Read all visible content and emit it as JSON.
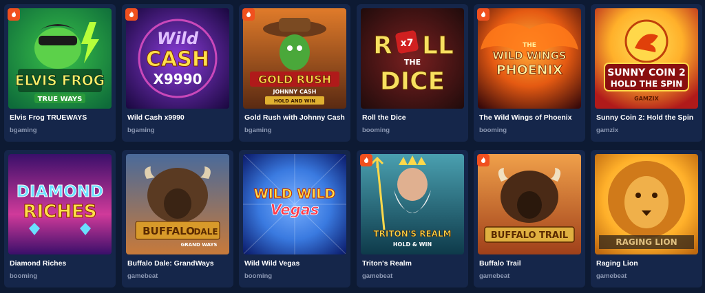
{
  "games": [
    {
      "title": "Elvis Frog TRUEWAYS",
      "provider": "bgaming",
      "hot": true,
      "art_lines": [
        "ELVIS FROG",
        "TRUE WAYS"
      ],
      "colors": [
        "#0e6b3a",
        "#39c24a"
      ]
    },
    {
      "title": "Wild Cash x9990",
      "provider": "bgaming",
      "hot": true,
      "art_lines": [
        "Wild",
        "CASH",
        "X9990"
      ],
      "colors": [
        "#2a1060",
        "#8a3bd8"
      ]
    },
    {
      "title": "Gold Rush with Johnny Cash",
      "provider": "bgaming",
      "hot": true,
      "art_lines": [
        "GOLD RUSH",
        "JOHNNY CASH",
        "HOLD AND WIN"
      ],
      "colors": [
        "#5a2a12",
        "#e07b2a"
      ]
    },
    {
      "title": "Roll the Dice",
      "provider": "booming",
      "hot": false,
      "art_lines": [
        "R",
        "x7",
        "LL",
        "THE",
        "DICE"
      ],
      "colors": [
        "#301414",
        "#7a2020"
      ]
    },
    {
      "title": "The Wild Wings of Phoenix",
      "provider": "booming",
      "hot": true,
      "art_lines": [
        "THE",
        "WILD WINGS",
        "PHOENIX"
      ],
      "colors": [
        "#3a0a0a",
        "#e55a12"
      ]
    },
    {
      "title": "Sunny Coin 2: Hold the Spin",
      "provider": "gamzix",
      "hot": false,
      "art_lines": [
        "SUNNY COIN 2",
        "HOLD THE SPIN",
        "GAMZIX"
      ],
      "colors": [
        "#b01a1a",
        "#ffb02a"
      ]
    },
    {
      "title": "Diamond Riches",
      "provider": "booming",
      "hot": false,
      "art_lines": [
        "DIAMOND",
        "RICHES"
      ],
      "colors": [
        "#3a0f6a",
        "#d03a9a"
      ]
    },
    {
      "title": "Buffalo Dale: GrandWays",
      "provider": "gamebeat",
      "hot": false,
      "art_lines": [
        "BUFFALO",
        "DALE",
        "GRAND WAYS"
      ],
      "colors": [
        "#2a3a5a",
        "#c87a3a"
      ]
    },
    {
      "title": "Wild Wild Vegas",
      "provider": "booming",
      "hot": false,
      "art_lines": [
        "WILD WILD",
        "Vegas"
      ],
      "colors": [
        "#0a2a8a",
        "#3a7ae0"
      ]
    },
    {
      "title": "Triton's Realm",
      "provider": "gamebeat",
      "hot": true,
      "art_lines": [
        "TRITON'S REALM",
        "HOLD & WIN"
      ],
      "colors": [
        "#0e3a4a",
        "#4aa0b0"
      ]
    },
    {
      "title": "Buffalo Trail",
      "provider": "gamebeat",
      "hot": true,
      "art_lines": [
        "BUFFALO TRAIL"
      ],
      "colors": [
        "#a0401a",
        "#f0a04a"
      ]
    },
    {
      "title": "Raging Lion",
      "provider": "gamebeat",
      "hot": false,
      "art_lines": [
        "RAGING LION"
      ],
      "colors": [
        "#c06a10",
        "#ffd34a"
      ]
    }
  ]
}
